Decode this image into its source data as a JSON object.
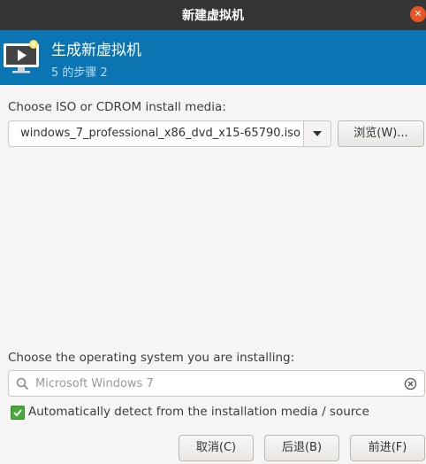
{
  "window": {
    "title": "新建虚拟机"
  },
  "header": {
    "title": "生成新虚拟机",
    "step": "5 的步骤 2"
  },
  "media": {
    "label": "Choose ISO or CDROM install media:",
    "value": "windows_7_professional_x86_dvd_x15-65790.iso",
    "browse_label": "浏览(W)..."
  },
  "os": {
    "label": "Choose the operating system you are installing:",
    "search_placeholder": "Microsoft Windows 7",
    "autodetect_label": "Automatically detect from the installation media / source",
    "autodetect_checked": true
  },
  "footer": {
    "cancel_label": "取消(C)",
    "back_label": "后退(B)",
    "forward_label": "前进(F)"
  },
  "colors": {
    "header_bg": "#0b75b3",
    "titlebar_bg": "#353535",
    "close_button": "#e95420",
    "checkbox_checked": "#46a93a"
  },
  "icons": {
    "close": "close-icon",
    "logo": "virtual-machine-monitor-icon",
    "dropdown": "chevron-down-icon",
    "search": "search-icon",
    "clear": "clear-icon",
    "check": "checkmark-icon"
  }
}
